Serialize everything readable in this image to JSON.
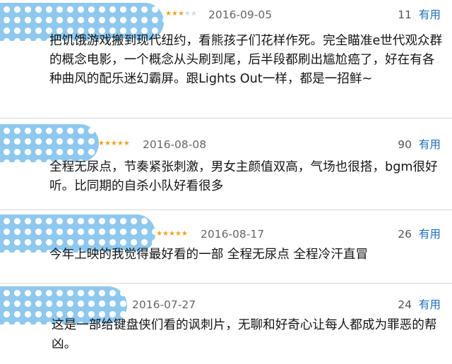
{
  "reviews": [
    {
      "rating": 3,
      "date": "2016-09-05",
      "votes": "11",
      "vote_label": "有用",
      "text": "把饥饿游戏搬到现代纽约，看熊孩子们花样作死。完全瞄准e世代观众群的概念电影，一个概念从头刷到尾，后半段都刷出尴尬癌了，好在有各种曲风的配乐迷幻霸屏。跟Lights Out一样，都是一招鲜~"
    },
    {
      "rating": 5,
      "date": "2016-08-08",
      "votes": "90",
      "vote_label": "有用",
      "text": "全程无尿点，节奏紧张刺激，男女主颜值双高，气场也很搭，bgm很好听。比同期的自杀小队好看很多"
    },
    {
      "rating": 5,
      "date": "2016-08-17",
      "votes": "26",
      "vote_label": "有用",
      "text": "今年上映的我觉得最好看的一部 全程无尿点 全程冷汗直冒"
    },
    {
      "rating": 0,
      "date": "2016-07-27",
      "votes": "24",
      "vote_label": "有用",
      "text": "这是一部给键盘侠们看的讽刺片，无聊和好奇心让每人都成为罪恶的帮凶。"
    }
  ],
  "colors": {
    "star_on": "#f4a21d",
    "star_off": "#d8d8d8",
    "mask": "#8fc8ee",
    "link": "#1f6fbf"
  },
  "icons": {
    "star": "star-icon",
    "mask": "censor-mask"
  }
}
